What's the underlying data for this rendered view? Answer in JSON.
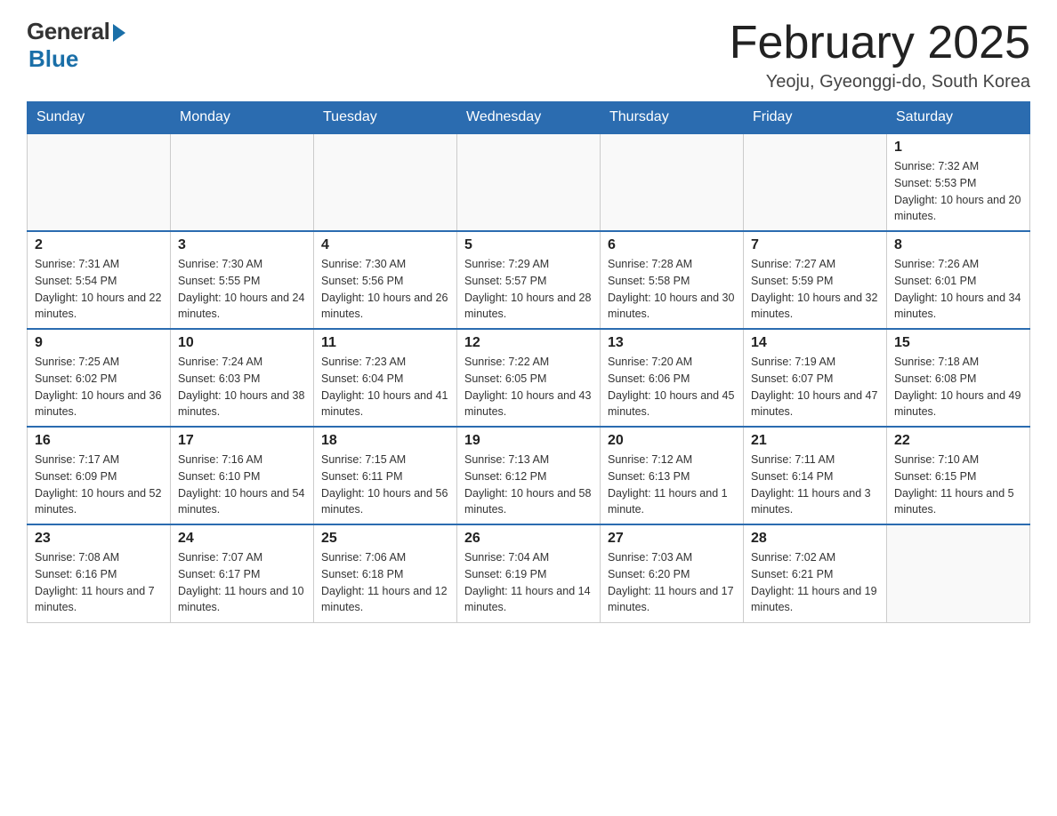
{
  "header": {
    "logo_general": "General",
    "logo_blue": "Blue",
    "title": "February 2025",
    "location": "Yeoju, Gyeonggi-do, South Korea"
  },
  "days_of_week": [
    "Sunday",
    "Monday",
    "Tuesday",
    "Wednesday",
    "Thursday",
    "Friday",
    "Saturday"
  ],
  "weeks": [
    [
      {
        "day": "",
        "sunrise": "",
        "sunset": "",
        "daylight": ""
      },
      {
        "day": "",
        "sunrise": "",
        "sunset": "",
        "daylight": ""
      },
      {
        "day": "",
        "sunrise": "",
        "sunset": "",
        "daylight": ""
      },
      {
        "day": "",
        "sunrise": "",
        "sunset": "",
        "daylight": ""
      },
      {
        "day": "",
        "sunrise": "",
        "sunset": "",
        "daylight": ""
      },
      {
        "day": "",
        "sunrise": "",
        "sunset": "",
        "daylight": ""
      },
      {
        "day": "1",
        "sunrise": "Sunrise: 7:32 AM",
        "sunset": "Sunset: 5:53 PM",
        "daylight": "Daylight: 10 hours and 20 minutes."
      }
    ],
    [
      {
        "day": "2",
        "sunrise": "Sunrise: 7:31 AM",
        "sunset": "Sunset: 5:54 PM",
        "daylight": "Daylight: 10 hours and 22 minutes."
      },
      {
        "day": "3",
        "sunrise": "Sunrise: 7:30 AM",
        "sunset": "Sunset: 5:55 PM",
        "daylight": "Daylight: 10 hours and 24 minutes."
      },
      {
        "day": "4",
        "sunrise": "Sunrise: 7:30 AM",
        "sunset": "Sunset: 5:56 PM",
        "daylight": "Daylight: 10 hours and 26 minutes."
      },
      {
        "day": "5",
        "sunrise": "Sunrise: 7:29 AM",
        "sunset": "Sunset: 5:57 PM",
        "daylight": "Daylight: 10 hours and 28 minutes."
      },
      {
        "day": "6",
        "sunrise": "Sunrise: 7:28 AM",
        "sunset": "Sunset: 5:58 PM",
        "daylight": "Daylight: 10 hours and 30 minutes."
      },
      {
        "day": "7",
        "sunrise": "Sunrise: 7:27 AM",
        "sunset": "Sunset: 5:59 PM",
        "daylight": "Daylight: 10 hours and 32 minutes."
      },
      {
        "day": "8",
        "sunrise": "Sunrise: 7:26 AM",
        "sunset": "Sunset: 6:01 PM",
        "daylight": "Daylight: 10 hours and 34 minutes."
      }
    ],
    [
      {
        "day": "9",
        "sunrise": "Sunrise: 7:25 AM",
        "sunset": "Sunset: 6:02 PM",
        "daylight": "Daylight: 10 hours and 36 minutes."
      },
      {
        "day": "10",
        "sunrise": "Sunrise: 7:24 AM",
        "sunset": "Sunset: 6:03 PM",
        "daylight": "Daylight: 10 hours and 38 minutes."
      },
      {
        "day": "11",
        "sunrise": "Sunrise: 7:23 AM",
        "sunset": "Sunset: 6:04 PM",
        "daylight": "Daylight: 10 hours and 41 minutes."
      },
      {
        "day": "12",
        "sunrise": "Sunrise: 7:22 AM",
        "sunset": "Sunset: 6:05 PM",
        "daylight": "Daylight: 10 hours and 43 minutes."
      },
      {
        "day": "13",
        "sunrise": "Sunrise: 7:20 AM",
        "sunset": "Sunset: 6:06 PM",
        "daylight": "Daylight: 10 hours and 45 minutes."
      },
      {
        "day": "14",
        "sunrise": "Sunrise: 7:19 AM",
        "sunset": "Sunset: 6:07 PM",
        "daylight": "Daylight: 10 hours and 47 minutes."
      },
      {
        "day": "15",
        "sunrise": "Sunrise: 7:18 AM",
        "sunset": "Sunset: 6:08 PM",
        "daylight": "Daylight: 10 hours and 49 minutes."
      }
    ],
    [
      {
        "day": "16",
        "sunrise": "Sunrise: 7:17 AM",
        "sunset": "Sunset: 6:09 PM",
        "daylight": "Daylight: 10 hours and 52 minutes."
      },
      {
        "day": "17",
        "sunrise": "Sunrise: 7:16 AM",
        "sunset": "Sunset: 6:10 PM",
        "daylight": "Daylight: 10 hours and 54 minutes."
      },
      {
        "day": "18",
        "sunrise": "Sunrise: 7:15 AM",
        "sunset": "Sunset: 6:11 PM",
        "daylight": "Daylight: 10 hours and 56 minutes."
      },
      {
        "day": "19",
        "sunrise": "Sunrise: 7:13 AM",
        "sunset": "Sunset: 6:12 PM",
        "daylight": "Daylight: 10 hours and 58 minutes."
      },
      {
        "day": "20",
        "sunrise": "Sunrise: 7:12 AM",
        "sunset": "Sunset: 6:13 PM",
        "daylight": "Daylight: 11 hours and 1 minute."
      },
      {
        "day": "21",
        "sunrise": "Sunrise: 7:11 AM",
        "sunset": "Sunset: 6:14 PM",
        "daylight": "Daylight: 11 hours and 3 minutes."
      },
      {
        "day": "22",
        "sunrise": "Sunrise: 7:10 AM",
        "sunset": "Sunset: 6:15 PM",
        "daylight": "Daylight: 11 hours and 5 minutes."
      }
    ],
    [
      {
        "day": "23",
        "sunrise": "Sunrise: 7:08 AM",
        "sunset": "Sunset: 6:16 PM",
        "daylight": "Daylight: 11 hours and 7 minutes."
      },
      {
        "day": "24",
        "sunrise": "Sunrise: 7:07 AM",
        "sunset": "Sunset: 6:17 PM",
        "daylight": "Daylight: 11 hours and 10 minutes."
      },
      {
        "day": "25",
        "sunrise": "Sunrise: 7:06 AM",
        "sunset": "Sunset: 6:18 PM",
        "daylight": "Daylight: 11 hours and 12 minutes."
      },
      {
        "day": "26",
        "sunrise": "Sunrise: 7:04 AM",
        "sunset": "Sunset: 6:19 PM",
        "daylight": "Daylight: 11 hours and 14 minutes."
      },
      {
        "day": "27",
        "sunrise": "Sunrise: 7:03 AM",
        "sunset": "Sunset: 6:20 PM",
        "daylight": "Daylight: 11 hours and 17 minutes."
      },
      {
        "day": "28",
        "sunrise": "Sunrise: 7:02 AM",
        "sunset": "Sunset: 6:21 PM",
        "daylight": "Daylight: 11 hours and 19 minutes."
      },
      {
        "day": "",
        "sunrise": "",
        "sunset": "",
        "daylight": ""
      }
    ]
  ]
}
